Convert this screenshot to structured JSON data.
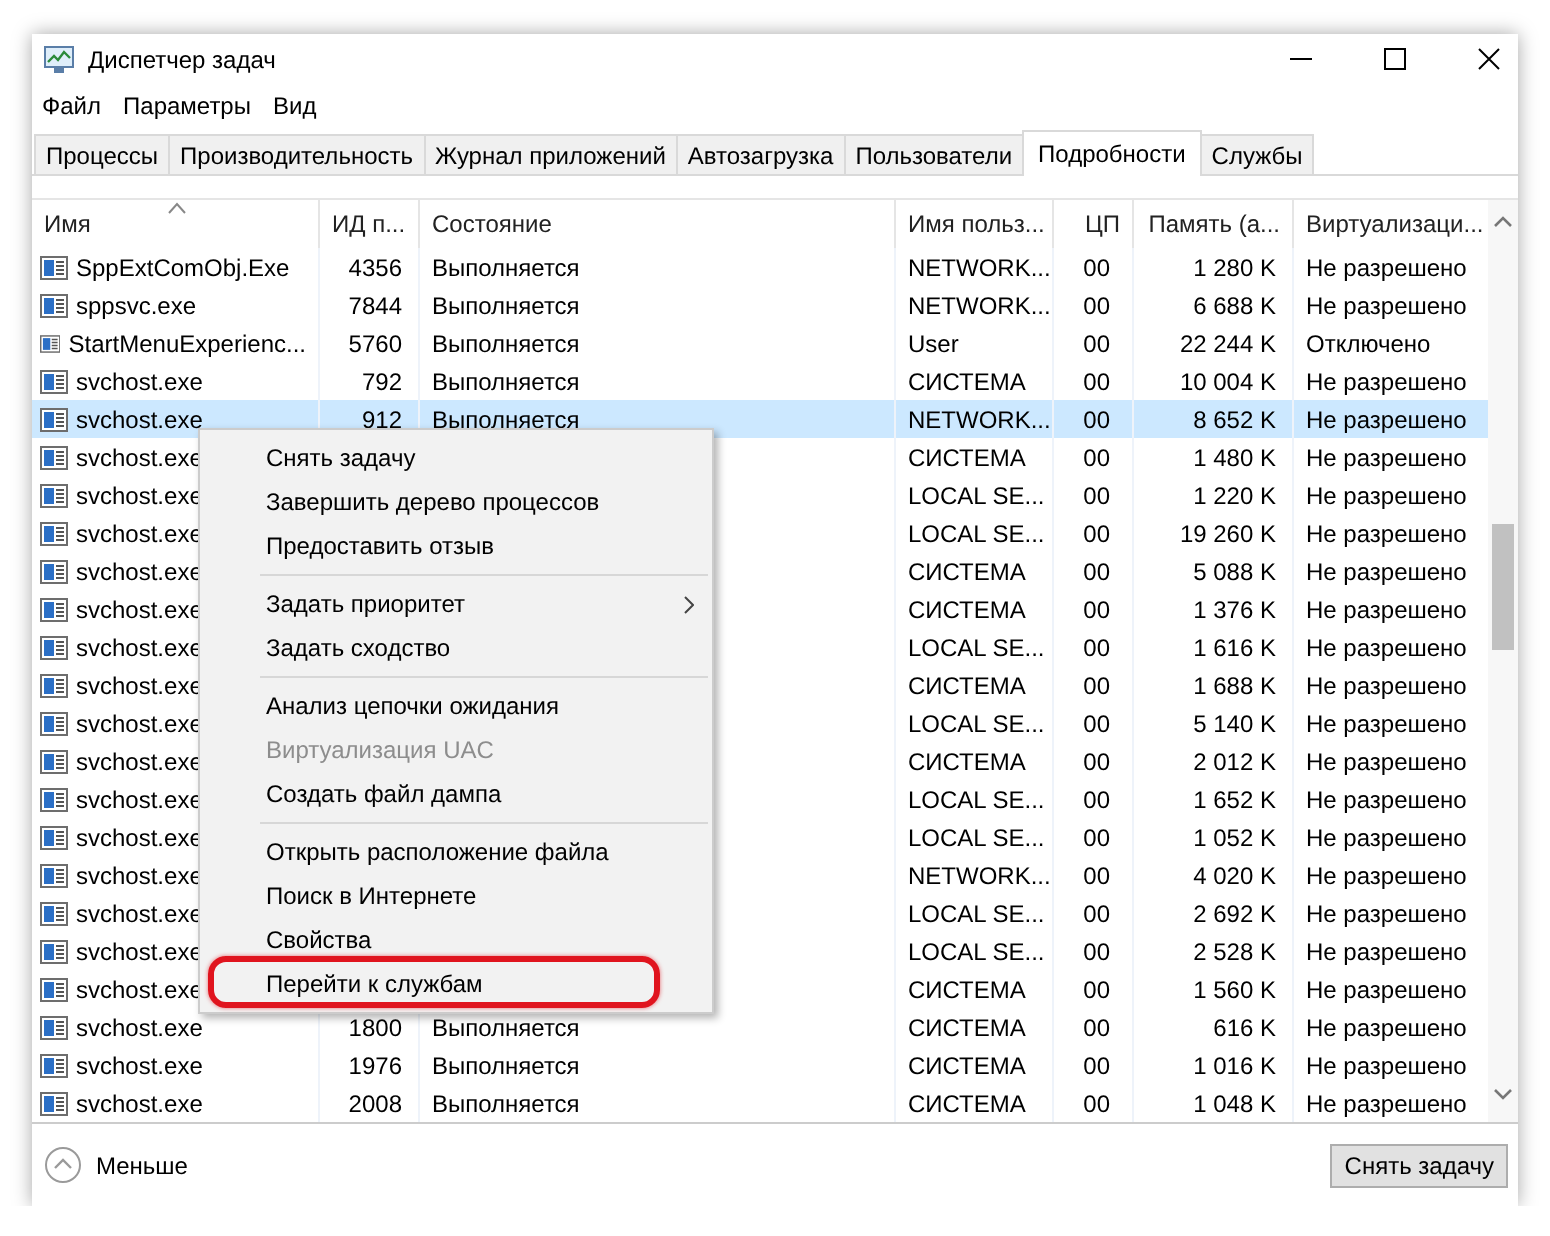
{
  "window": {
    "title": "Диспетчер задач"
  },
  "menu_bar": [
    "Файл",
    "Параметры",
    "Вид"
  ],
  "tabs": [
    {
      "label": "Процессы",
      "selected": false
    },
    {
      "label": "Производительность",
      "selected": false
    },
    {
      "label": "Журнал приложений",
      "selected": false
    },
    {
      "label": "Автозагрузка",
      "selected": false
    },
    {
      "label": "Пользователи",
      "selected": false
    },
    {
      "label": "Подробности",
      "selected": true
    },
    {
      "label": "Службы",
      "selected": false
    }
  ],
  "table": {
    "columns": [
      {
        "label": "Имя",
        "sorted": true
      },
      {
        "label": "ИД п...",
        "sorted": false
      },
      {
        "label": "Состояние",
        "sorted": false
      },
      {
        "label": "Имя польз...",
        "sorted": false
      },
      {
        "label": "ЦП",
        "sorted": false
      },
      {
        "label": "Память (а...",
        "sorted": false
      },
      {
        "label": "Виртуализаци...",
        "sorted": false
      }
    ],
    "rows": [
      {
        "name": "SppExtComObj.Exe",
        "pid": "4356",
        "status": "Выполняется",
        "user": "NETWORK...",
        "cpu": "00",
        "memory": "1 280 K",
        "virtualization": "Не разрешено",
        "selected": false
      },
      {
        "name": "sppsvc.exe",
        "pid": "7844",
        "status": "Выполняется",
        "user": "NETWORK...",
        "cpu": "00",
        "memory": "6 688 K",
        "virtualization": "Не разрешено",
        "selected": false
      },
      {
        "name": "StartMenuExperienc...",
        "pid": "5760",
        "status": "Выполняется",
        "user": "User",
        "cpu": "00",
        "memory": "22 244 K",
        "virtualization": "Отключено",
        "selected": false
      },
      {
        "name": "svchost.exe",
        "pid": "792",
        "status": "Выполняется",
        "user": "СИСТЕМА",
        "cpu": "00",
        "memory": "10 004 K",
        "virtualization": "Не разрешено",
        "selected": false
      },
      {
        "name": "svchost.exe",
        "pid": "912",
        "status": "Выполняется",
        "user": "NETWORK...",
        "cpu": "00",
        "memory": "8 652 K",
        "virtualization": "Не разрешено",
        "selected": true
      },
      {
        "name": "svchost.exe",
        "user": "СИСТЕМА",
        "cpu": "00",
        "memory": "1 480 K",
        "virtualization": "Не разрешено",
        "selected": false
      },
      {
        "name": "svchost.exe",
        "user": "LOCAL SE...",
        "cpu": "00",
        "memory": "1 220 K",
        "virtualization": "Не разрешено",
        "selected": false
      },
      {
        "name": "svchost.exe",
        "user": "LOCAL SE...",
        "cpu": "00",
        "memory": "19 260 K",
        "virtualization": "Не разрешено",
        "selected": false
      },
      {
        "name": "svchost.exe",
        "user": "СИСТЕМА",
        "cpu": "00",
        "memory": "5 088 K",
        "virtualization": "Не разрешено",
        "selected": false
      },
      {
        "name": "svchost.exe",
        "user": "СИСТЕМА",
        "cpu": "00",
        "memory": "1 376 K",
        "virtualization": "Не разрешено",
        "selected": false
      },
      {
        "name": "svchost.exe",
        "user": "LOCAL SE...",
        "cpu": "00",
        "memory": "1 616 K",
        "virtualization": "Не разрешено",
        "selected": false
      },
      {
        "name": "svchost.exe",
        "user": "СИСТЕМА",
        "cpu": "00",
        "memory": "1 688 K",
        "virtualization": "Не разрешено",
        "selected": false
      },
      {
        "name": "svchost.exe",
        "user": "LOCAL SE...",
        "cpu": "00",
        "memory": "5 140 K",
        "virtualization": "Не разрешено",
        "selected": false
      },
      {
        "name": "svchost.exe",
        "user": "СИСТЕМА",
        "cpu": "00",
        "memory": "2 012 K",
        "virtualization": "Не разрешено",
        "selected": false
      },
      {
        "name": "svchost.exe",
        "user": "LOCAL SE...",
        "cpu": "00",
        "memory": "1 652 K",
        "virtualization": "Не разрешено",
        "selected": false
      },
      {
        "name": "svchost.exe",
        "user": "LOCAL SE...",
        "cpu": "00",
        "memory": "1 052 K",
        "virtualization": "Не разрешено",
        "selected": false
      },
      {
        "name": "svchost.exe",
        "user": "NETWORK...",
        "cpu": "00",
        "memory": "4 020 K",
        "virtualization": "Не разрешено",
        "selected": false
      },
      {
        "name": "svchost.exe",
        "user": "LOCAL SE...",
        "cpu": "00",
        "memory": "2 692 K",
        "virtualization": "Не разрешено",
        "selected": false
      },
      {
        "name": "svchost.exe",
        "user": "LOCAL SE...",
        "cpu": "00",
        "memory": "2 528 K",
        "virtualization": "Не разрешено",
        "selected": false
      },
      {
        "name": "svchost.exe",
        "user": "СИСТЕМА",
        "cpu": "00",
        "memory": "1 560 K",
        "virtualization": "Не разрешено",
        "selected": false
      },
      {
        "name": "svchost.exe",
        "pid": "1800",
        "status": "Выполняется",
        "user": "СИСТЕМА",
        "cpu": "00",
        "memory": "616 K",
        "virtualization": "Не разрешено",
        "selected": false
      },
      {
        "name": "svchost.exe",
        "pid": "1976",
        "status": "Выполняется",
        "user": "СИСТЕМА",
        "cpu": "00",
        "memory": "1 016 K",
        "virtualization": "Не разрешено",
        "selected": false
      },
      {
        "name": "svchost.exe",
        "pid": "2008",
        "status": "Выполняется",
        "user": "СИСТЕМА",
        "cpu": "00",
        "memory": "1 048 K",
        "virtualization": "Не разрешено",
        "selected": false
      }
    ]
  },
  "context_menu": {
    "groups": [
      [
        {
          "label": "Снять задачу",
          "disabled": false,
          "submenu": false,
          "annotated": false
        },
        {
          "label": "Завершить дерево процессов",
          "disabled": false,
          "submenu": false,
          "annotated": false
        },
        {
          "label": "Предоставить отзыв",
          "disabled": false,
          "submenu": false,
          "annotated": false
        }
      ],
      [
        {
          "label": "Задать приоритет",
          "disabled": false,
          "submenu": true,
          "annotated": false
        },
        {
          "label": "Задать сходство",
          "disabled": false,
          "submenu": false,
          "annotated": false
        }
      ],
      [
        {
          "label": "Анализ цепочки ожидания",
          "disabled": false,
          "submenu": false,
          "annotated": false
        },
        {
          "label": "Виртуализация UAC",
          "disabled": true,
          "submenu": false,
          "annotated": false
        },
        {
          "label": "Создать файл дампа",
          "disabled": false,
          "submenu": false,
          "annotated": false
        }
      ],
      [
        {
          "label": "Открыть расположение файла",
          "disabled": false,
          "submenu": false,
          "annotated": false
        },
        {
          "label": "Поиск в Интернете",
          "disabled": false,
          "submenu": false,
          "annotated": false
        },
        {
          "label": "Свойства",
          "disabled": false,
          "submenu": false,
          "annotated": false
        },
        {
          "label": "Перейти к службам",
          "disabled": false,
          "submenu": false,
          "annotated": true
        }
      ]
    ]
  },
  "footer": {
    "toggle": "Меньше",
    "button": "Снять задачу"
  }
}
